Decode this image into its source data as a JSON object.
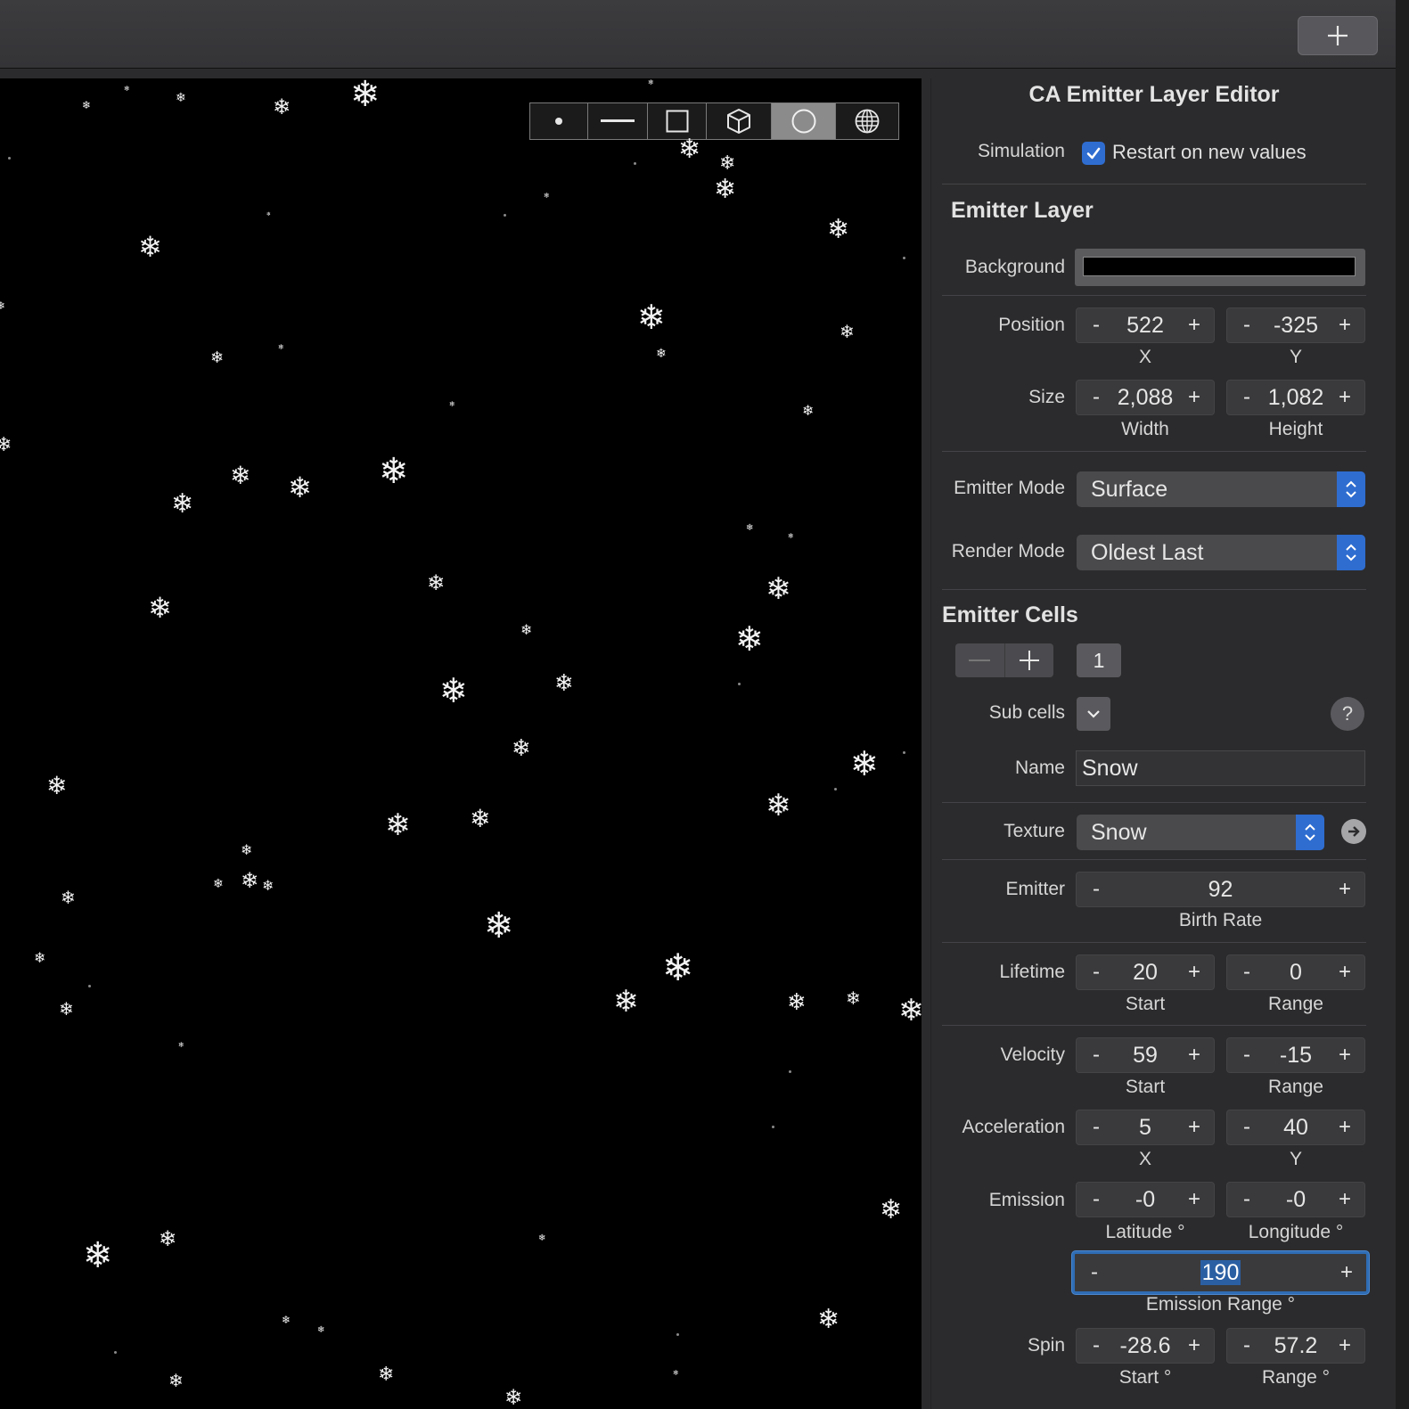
{
  "window": {
    "add_button_icon": "plus-icon"
  },
  "canvas": {
    "background": "#000000",
    "shape_buttons": [
      {
        "name": "point",
        "icon": "point-icon"
      },
      {
        "name": "line",
        "icon": "line-icon"
      },
      {
        "name": "rectangle",
        "icon": "rectangle-icon"
      },
      {
        "name": "cuboid",
        "icon": "cube-icon"
      },
      {
        "name": "circle",
        "icon": "circle-icon",
        "selected": true
      },
      {
        "name": "sphere",
        "icon": "globe-icon"
      }
    ]
  },
  "inspector": {
    "title": "CA Emitter Layer Editor",
    "simulation": {
      "label": "Simulation",
      "checkbox_label": "Restart on new values",
      "checked": true
    },
    "emitter_layer": {
      "heading": "Emitter Layer",
      "background_label": "Background",
      "background_color": "#000000",
      "position": {
        "label": "Position",
        "x": "522",
        "y": "-325",
        "x_caption": "X",
        "y_caption": "Y"
      },
      "size": {
        "label": "Size",
        "width": "2,088",
        "height": "1,082",
        "width_caption": "Width",
        "height_caption": "Height"
      },
      "emitter_mode": {
        "label": "Emitter Mode",
        "value": "Surface"
      },
      "render_mode": {
        "label": "Render Mode",
        "value": "Oldest Last"
      }
    },
    "emitter_cells": {
      "heading": "Emitter Cells",
      "count": "1",
      "sub_cells_label": "Sub cells",
      "help_label": "?",
      "name": {
        "label": "Name",
        "value": "Snow"
      },
      "texture": {
        "label": "Texture",
        "value": "Snow"
      },
      "emitter": {
        "label": "Emitter",
        "value": "92",
        "caption": "Birth Rate"
      },
      "lifetime": {
        "label": "Lifetime",
        "start": "20",
        "range": "0",
        "start_caption": "Start",
        "range_caption": "Range"
      },
      "velocity": {
        "label": "Velocity",
        "start": "59",
        "range": "-15",
        "start_caption": "Start",
        "range_caption": "Range"
      },
      "acceleration": {
        "label": "Acceleration",
        "x": "5",
        "y": "40",
        "x_caption": "X",
        "y_caption": "Y"
      },
      "emission": {
        "label": "Emission",
        "latitude": "-0",
        "longitude": "-0",
        "latitude_caption": "Latitude °",
        "longitude_caption": "Longitude °",
        "range": "190",
        "range_caption": "Emission Range °"
      },
      "spin": {
        "label": "Spin",
        "start": "-28.6",
        "range": "57.2",
        "start_caption": "Start °",
        "range_caption": "Range °"
      }
    },
    "stepper_minus": "-",
    "stepper_plus": "+"
  }
}
